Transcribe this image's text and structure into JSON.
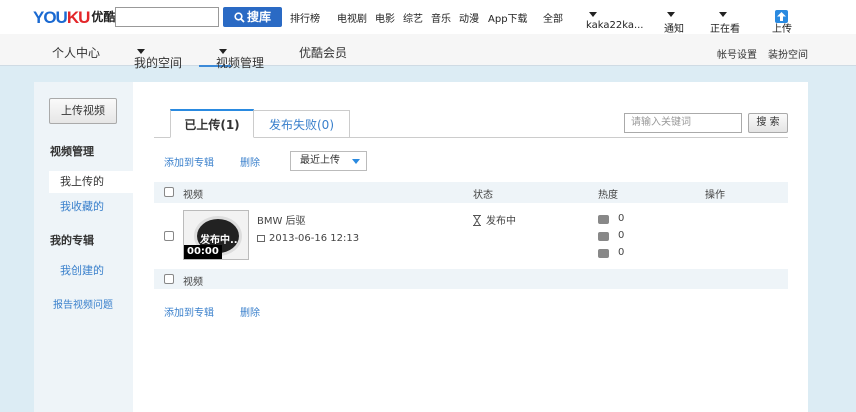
{
  "header": {
    "logo_main": "YOU",
    "logo_ku": "KU",
    "logo_cn": "优酷",
    "search_value": "",
    "search_button": "搜库",
    "nav": [
      "排行榜",
      "电视剧",
      "电影",
      "综艺",
      "音乐",
      "动漫",
      "App下载",
      "全部"
    ],
    "user": "kaka22ka...",
    "notify": "通知",
    "watching": "正在看",
    "upload": "上传"
  },
  "subnav": {
    "items": [
      "个人中心",
      "我的空间",
      "视频管理",
      "优酷会员"
    ],
    "right": [
      "帐号设置",
      "装扮空间"
    ]
  },
  "sidebar": {
    "upload_button": "上传视频",
    "section1": "视频管理",
    "uploaded": "我上传的",
    "favorites": "我收藏的",
    "section2": "我的专辑",
    "created": "我创建的",
    "report": "报告视频问题"
  },
  "tabs": {
    "uploaded": "已上传(1)",
    "failed": "发布失败(0)"
  },
  "search": {
    "placeholder": "请输入关键词",
    "button": "搜 索"
  },
  "actions": {
    "add_to_album": "添加到专辑",
    "delete": "删除",
    "sort": "最近上传"
  },
  "table": {
    "headers": [
      "视频",
      "状态",
      "热度",
      "操作"
    ],
    "footer_label": "视频",
    "rows": [
      {
        "thumb_label": "发布中..",
        "duration": "00:00",
        "title": "BMW 后驱",
        "date": "2013-06-16 12:13",
        "status": "发布中",
        "plays": "0",
        "comments": "0",
        "shares": "0"
      }
    ]
  },
  "colors": {
    "accent": "#2a6ac4",
    "link": "#3a80cc",
    "page_bg": "#dcecf4"
  }
}
